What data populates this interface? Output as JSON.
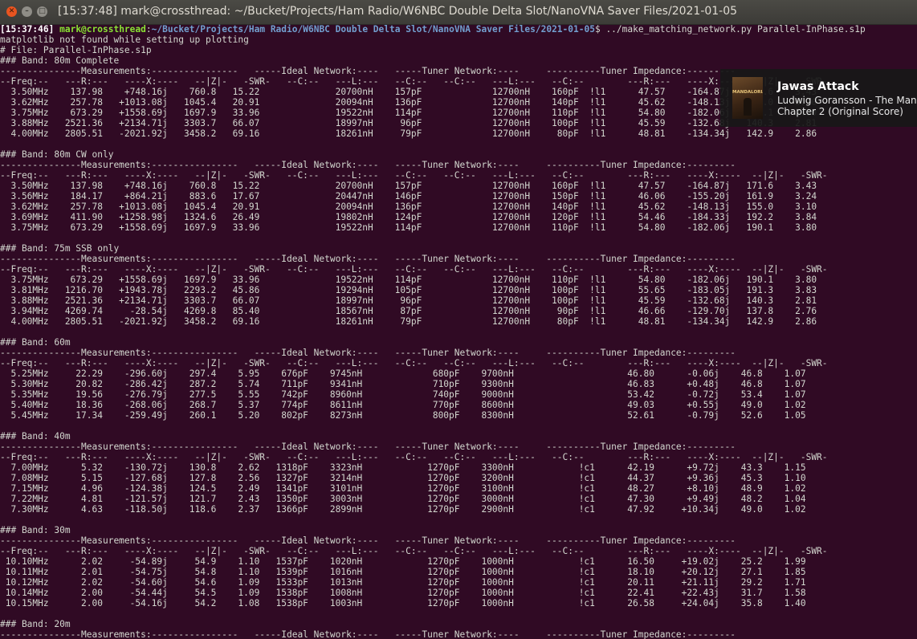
{
  "window": {
    "title": "[15:37:48] mark@crossthread: ~/Bucket/Projects/Ham Radio/W6NBC Double Delta Slot/NanoVNA Saver Files/2021-01-05",
    "close_glyph": "✕",
    "minimize_glyph": "–",
    "maximize_glyph": "□"
  },
  "prompt": {
    "time": "[15:37:46]",
    "userhost": "mark@crossthread",
    "sep": ":",
    "cwd": "~/Bucket/Projects/Ham Radio/W6NBC Double Delta Slot/NanoVNA Saver Files/2021-01-05",
    "dollar": "$",
    "command": " ../make_matching_network.py Parallel-InPhase.s1p"
  },
  "output_lines": [
    "matplotlib not found while setting up plotting",
    "# File: Parallel-InPhase.s1p",
    "### Band: 80m Complete",
    "---------------Measurements:----------------   -----Ideal Network:----   -----Tuner Network:----     ----------Tuner Impedance:---------",
    "--Freq:--   ---R:---   ----X:----   --|Z|-   -SWR-   --C:--   ---L:---   --C:--   --C:--   ---L:---   --C:--        ---R:---   ----X:----  --|Z|-   -SWR-",
    "  3.50MHz    137.98    +748.16j    760.8   15.22              20700nH    157pF             12700nH    160pF  !l1      47.57    -164.87j   171.6    3.43",
    "  3.62MHz    257.78   +1013.08j   1045.4   20.91              20094nH    136pF             12700nH    140pF  !l1      45.62    -148.13j   155.0    3.10",
    "  3.75MHz    673.29   +1558.69j   1697.9   33.96              19522nH    114pF             12700nH    110pF  !l1      54.80    -182.06j   190.1    3.80",
    "  3.88MHz   2521.36   +2134.71j   3303.7   66.07              18997nH     96pF             12700nH    100pF  !l1      45.59    -132.68j   140.3    2.81",
    "  4.00MHz   2805.51   -2021.92j   3458.2   69.16              18261nH     79pF             12700nH     80pF  !l1      48.81    -134.34j   142.9    2.86",
    "",
    "### Band: 80m CW only",
    "---------------Measurements:----------------   -----Ideal Network:----   -----Tuner Network:----     ----------Tuner Impedance:---------",
    "--Freq:--   ---R:---   ----X:----   --|Z|-   -SWR-   --C:--   ---L:---   --C:--   --C:--   ---L:---   --C:--        ---R:---   ----X:----  --|Z|-   -SWR-",
    "  3.50MHz    137.98    +748.16j    760.8   15.22              20700nH    157pF             12700nH    160pF  !l1      47.57    -164.87j   171.6    3.43",
    "  3.56MHz    184.17    +864.21j    883.6   17.67              20447nH    146pF             12700nH    150pF  !l1      46.06    -155.20j   161.9    3.24",
    "  3.62MHz    257.78   +1013.08j   1045.4   20.91              20094nH    136pF             12700nH    140pF  !l1      45.62    -148.13j   155.0    3.10",
    "  3.69MHz    411.90   +1258.98j   1324.6   26.49              19802nH    124pF             12700nH    120pF  !l1      54.46    -184.33j   192.2    3.84",
    "  3.75MHz    673.29   +1558.69j   1697.9   33.96              19522nH    114pF             12700nH    110pF  !l1      54.80    -182.06j   190.1    3.80",
    "",
    "### Band: 75m SSB only",
    "---------------Measurements:----------------   -----Ideal Network:----   -----Tuner Network:----     ----------Tuner Impedance:---------",
    "--Freq:--   ---R:---   ----X:----   --|Z|-   -SWR-   --C:--   ---L:---   --C:--   --C:--   ---L:---   --C:--        ---R:---   ----X:----  --|Z|-   -SWR-",
    "  3.75MHz    673.29   +1558.69j   1697.9   33.96              19522nH    114pF             12700nH    110pF  !l1      54.80    -182.06j   190.1    3.80",
    "  3.81MHz   1216.70   +1943.78j   2293.2   45.86              19294nH    105pF             12700nH    100pF  !l1      55.65    -183.05j   191.3    3.83",
    "  3.88MHz   2521.36   +2134.71j   3303.7   66.07              18997nH     96pF             12700nH    100pF  !l1      45.59    -132.68j   140.3    2.81",
    "  3.94MHz   4269.74     -28.54j   4269.8   85.40              18567nH     87pF             12700nH     90pF  !l1      46.66    -129.70j   137.8    2.76",
    "  4.00MHz   2805.51   -2021.92j   3458.2   69.16              18261nH     79pF             12700nH     80pF  !l1      48.81    -134.34j   142.9    2.86",
    "",
    "### Band: 60m",
    "---------------Measurements:----------------   -----Ideal Network:----   -----Tuner Network:----     ----------Tuner Impedance:---------",
    "--Freq:--   ---R:---   ----X:----   --|Z|-   -SWR-   --C:--   ---L:---   --C:--   --C:--   ---L:---   --C:--        ---R:---   ----X:----  --|Z|-   -SWR-",
    "  5.25MHz     22.29    -296.60j    297.4    5.95    676pF    9745nH             680pF    9700nH                     46.80      -0.06j    46.8    1.07",
    "  5.30MHz     20.82    -286.42j    287.2    5.74    711pF    9341nH             710pF    9300nH                     46.83      +0.48j    46.8    1.07",
    "  5.35MHz     19.56    -276.79j    277.5    5.55    742pF    8960nH             740pF    9000nH                     53.42      -0.72j    53.4    1.07",
    "  5.40MHz     18.36    -268.06j    268.7    5.37    774pF    8611nH             770pF    8600nH                     49.03      +0.55j    49.0    1.02",
    "  5.45MHz     17.34    -259.49j    260.1    5.20    802pF    8273nH             800pF    8300nH                     52.61      -0.79j    52.6    1.05",
    "",
    "### Band: 40m",
    "---------------Measurements:----------------   -----Ideal Network:----   -----Tuner Network:----     ----------Tuner Impedance:---------",
    "--Freq:--   ---R:---   ----X:----   --|Z|-   -SWR-   --C:--   ---L:---   --C:--   --C:--   ---L:---   --C:--        ---R:---   ----X:----  --|Z|-   -SWR-",
    "  7.00MHz      5.32    -130.72j    130.8    2.62   1318pF    3323nH            1270pF    3300nH            !c1      42.19      +9.72j    43.3    1.15",
    "  7.08MHz      5.15    -127.68j    127.8    2.56   1327pF    3214nH            1270pF    3200nH            !c1      44.37      +9.36j    45.3    1.10",
    "  7.15MHz      4.96    -124.38j    124.5    2.49   1341pF    3101nH            1270pF    3100nH            !c1      48.27      +8.10j    48.9    1.02",
    "  7.22MHz      4.81    -121.57j    121.7    2.43   1350pF    3003nH            1270pF    3000nH            !c1      47.30      +9.49j    48.2    1.04",
    "  7.30MHz      4.63    -118.50j    118.6    2.37   1366pF    2899nH            1270pF    2900nH            !c1      47.92     +10.34j    49.0    1.02",
    "",
    "### Band: 30m",
    "---------------Measurements:----------------   -----Ideal Network:----   -----Tuner Network:----     ----------Tuner Impedance:---------",
    "--Freq:--   ---R:---   ----X:----   --|Z|-   -SWR-   --C:--   ---L:---   --C:--   --C:--   ---L:---   --C:--        ---R:---   ----X:----  --|Z|-   -SWR-",
    " 10.10MHz      2.02     -54.89j     54.9    1.10   1537pF    1020nH            1270pF    1000nH            !c1      16.50     +19.02j    25.2    1.99",
    " 10.11MHz      2.01     -54.75j     54.8    1.10   1539pF    1016nH            1270pF    1000nH            !c1      18.10     +20.12j    27.1    1.85",
    " 10.12MHz      2.02     -54.60j     54.6    1.09   1533pF    1013nH            1270pF    1000nH            !c1      20.11     +21.11j    29.2    1.71",
    " 10.14MHz      2.00     -54.44j     54.5    1.09   1538pF    1008nH            1270pF    1000nH            !c1      22.41     +22.43j    31.7    1.58",
    " 10.15MHz      2.00     -54.16j     54.2    1.08   1538pF    1003nH            1270pF    1000nH            !c1      26.58     +24.04j    35.8    1.40",
    "",
    "### Band: 20m",
    "---------------Measurements:----------------   -----Ideal Network:----   -----Tuner Network:----     ----------Tuner Impedance:---------"
  ],
  "notification": {
    "album_art_text": "MANDALORIAN",
    "title": "Jawas Attack",
    "line1": "Ludwig Goransson - The Mandalorian:",
    "line2": "Chapter 2 (Original Score)"
  },
  "colors": {
    "terminal_bg": "#300a24",
    "terminal_fg": "#d3d7cf",
    "prompt_user": "#8ae234",
    "prompt_path": "#729fcf",
    "titlebar": "#3c3b37",
    "close_button": "#e95420"
  }
}
